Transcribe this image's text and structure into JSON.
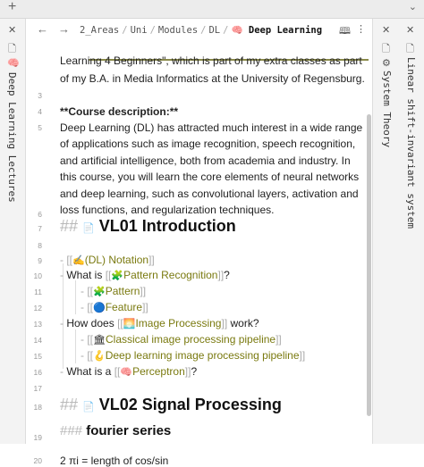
{
  "tabs": {
    "plus": "+",
    "chevron": "⌄"
  },
  "left_panel": {
    "close": "✕",
    "file_icon": "🗋",
    "emoji": "🧠",
    "title": "Deep Learning Lectures"
  },
  "right_panel": {
    "close": "✕",
    "file_icon": "🗋",
    "item1_icon": "⚙",
    "item1_title": "System Theory",
    "item2_title": "Linear shift-invariant system"
  },
  "navbar": {
    "back": "←",
    "forward": "→",
    "breadcrumb": [
      "2_Areas",
      "Uni",
      "Modules",
      "DL"
    ],
    "current_emoji": "🧠",
    "current": "Deep Learning",
    "separator": "/",
    "book_icon": "🕮",
    "more_icon": "⋮"
  },
  "editor": {
    "line_numbers": [
      "3",
      "4",
      "5",
      "6",
      "7",
      "8",
      "9",
      "10",
      "11",
      "12",
      "13",
      "14",
      "15",
      "16",
      "17",
      "18",
      "19",
      "20"
    ],
    "intro_line1": "Learning 4 Beginners\", which is part of my extra classes as part",
    "intro_line2": "of my B.A. in Media Informatics at the University of Regensburg.",
    "course_heading": "**Course description:**",
    "desc_lines": [
      "Deep Learning (DL) has attracted much interest in a wide range",
      "of applications such as image recognition, speech recognition,",
      "and artificial intelligence, both from academia and industry. In",
      "this course, you will learn the core elements of neural networks",
      "and deep learning, such as convolutional layers, activation and",
      "loss functions, and regularization techniques."
    ],
    "h2_prefix": "##",
    "h3_prefix": "###",
    "h2_icon": "📄",
    "h2_a": "VL01 Introduction",
    "h2_b": "VL02 Signal Processing",
    "h3_a": "fourier series",
    "bullet": "-",
    "open": "[[",
    "close": "]]",
    "item_notation_emoji": "✍",
    "item_notation": "(DL) Notation",
    "what_is": "What is",
    "q": "?",
    "pattern_rec_emoji": "🧩",
    "pattern_rec": "Pattern Recognition",
    "pattern_emoji": "🧩",
    "pattern": "Pattern",
    "feature_emoji": "🔵",
    "feature": "Feature",
    "how_does": "How does",
    "work": "work?",
    "imgproc_emoji": "🌅",
    "imgproc": "Image Processing",
    "classical_emoji": "🏛",
    "classical": "Classical image processing pipeline",
    "deep_emoji": "🪝",
    "deep": "Deep learning image processing pipeline",
    "what_is_a": "What is a",
    "perceptron_emoji": "🧠",
    "perceptron": "Perceptron",
    "last_partial": "2 πi = length of cos/sin"
  }
}
